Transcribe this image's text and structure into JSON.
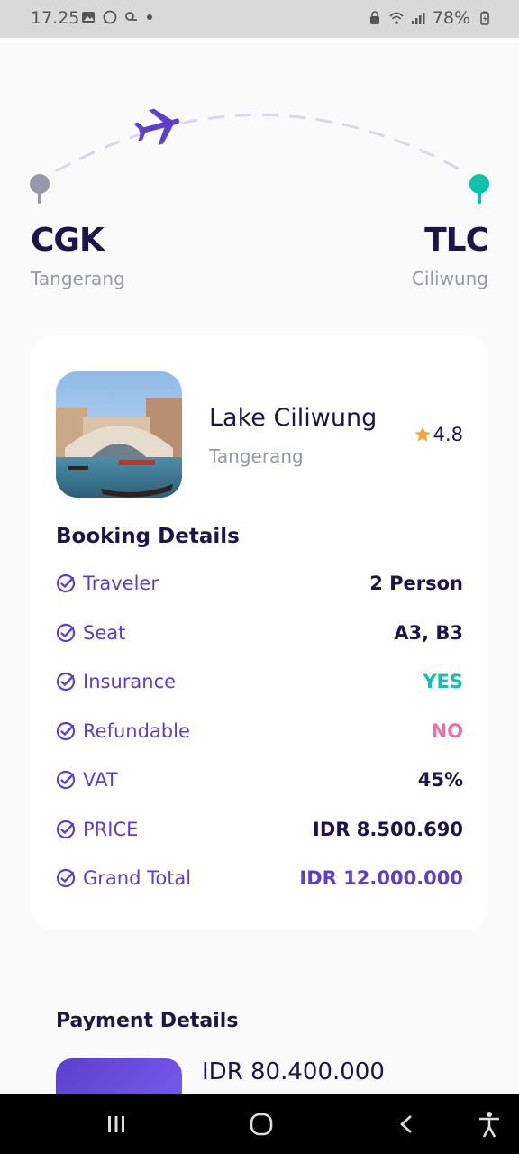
{
  "status_bar": {
    "time": "17.25",
    "battery": "78%",
    "left_icons": [
      "image-icon",
      "whatsapp-icon",
      "weather-icon",
      "dot-icon"
    ],
    "right_icons": [
      "lock-icon",
      "wifi-icon",
      "signal-icon",
      "battery-icon"
    ]
  },
  "route": {
    "from": {
      "code": "CGK",
      "city": "Tangerang"
    },
    "to": {
      "code": "TLC",
      "city": "Ciliwung"
    },
    "plane_icon": "plane-icon",
    "colors": {
      "from_pin": "#9698A9",
      "to_pin": "#0EC3AE",
      "plane": "#5C40CC"
    }
  },
  "destination": {
    "name": "Lake Ciliwung",
    "city": "Tangerang",
    "rating": "4.8"
  },
  "booking": {
    "title": "Booking Details",
    "rows": [
      {
        "label": "Traveler",
        "value": "2 Person",
        "color": "#1F1449"
      },
      {
        "label": "Seat",
        "value": "A3, B3",
        "color": "#1F1449"
      },
      {
        "label": "Insurance",
        "value": "YES",
        "color": "#0EC3AE"
      },
      {
        "label": "Refundable",
        "value": "NO",
        "color": "#EB70A5"
      },
      {
        "label": "VAT",
        "value": "45%",
        "color": "#1F1449"
      },
      {
        "label": "PRICE",
        "value": "IDR 8.500.690",
        "color": "#1F1449"
      },
      {
        "label": "Grand Total",
        "value": "IDR 12.000.000",
        "color": "#5C40CC"
      }
    ]
  },
  "payment": {
    "title": "Payment Details",
    "amount": "IDR 80.400.000"
  },
  "nav_bar": {
    "icons": [
      "recents-icon",
      "home-icon",
      "back-icon",
      "accessibility-icon"
    ]
  }
}
